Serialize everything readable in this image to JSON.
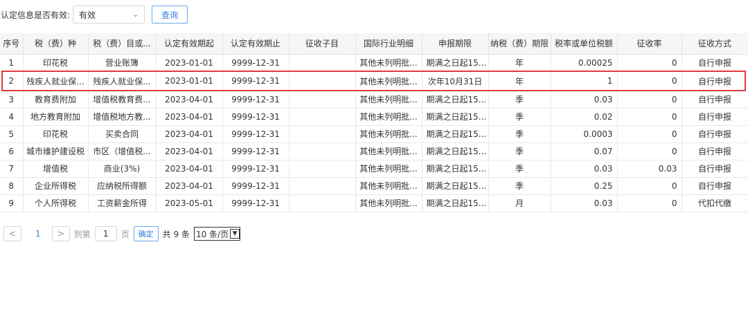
{
  "filter": {
    "label": "认定信息是否有效:",
    "select_value": "有效",
    "query_button": "查询"
  },
  "table": {
    "headers": [
      "序号",
      "税（费）种",
      "税（费）目或...",
      "认定有效期起",
      "认定有效期止",
      "征收子目",
      "国际行业明细",
      "申报期限",
      "纳税（费）期限",
      "税率或单位税额",
      "征收率",
      "征收方式"
    ],
    "rows": [
      [
        "1",
        "印花税",
        "营业账簿",
        "2023-01-01",
        "9999-12-31",
        "",
        "其他未列明批...",
        "期满之日起15...",
        "年",
        "0.00025",
        "0",
        "自行申报"
      ],
      [
        "2",
        "残疾人就业保...",
        "残疾人就业保...",
        "2023-01-01",
        "9999-12-31",
        "",
        "其他未列明批...",
        "次年10月31日",
        "年",
        "1",
        "0",
        "自行申报"
      ],
      [
        "3",
        "教育费附加",
        "增值税教育费...",
        "2023-04-01",
        "9999-12-31",
        "",
        "其他未列明批...",
        "期满之日起15...",
        "季",
        "0.03",
        "0",
        "自行申报"
      ],
      [
        "4",
        "地方教育附加",
        "增值税地方教...",
        "2023-04-01",
        "9999-12-31",
        "",
        "其他未列明批...",
        "期满之日起15...",
        "季",
        "0.02",
        "0",
        "自行申报"
      ],
      [
        "5",
        "印花税",
        "买卖合同",
        "2023-04-01",
        "9999-12-31",
        "",
        "其他未列明批...",
        "期满之日起15...",
        "季",
        "0.0003",
        "0",
        "自行申报"
      ],
      [
        "6",
        "城市维护建设税",
        "市区（增值税...",
        "2023-04-01",
        "9999-12-31",
        "",
        "其他未列明批...",
        "期满之日起15...",
        "季",
        "0.07",
        "0",
        "自行申报"
      ],
      [
        "7",
        "增值税",
        "商业(3%)",
        "2023-04-01",
        "9999-12-31",
        "",
        "其他未列明批...",
        "期满之日起15...",
        "季",
        "0.03",
        "0.03",
        "自行申报"
      ],
      [
        "8",
        "企业所得税",
        "应纳税所得额",
        "2023-04-01",
        "9999-12-31",
        "",
        "其他未列明批...",
        "期满之日起15...",
        "季",
        "0.25",
        "0",
        "自行申报"
      ],
      [
        "9",
        "个人所得税",
        "工资薪金所得",
        "2023-05-01",
        "9999-12-31",
        "",
        "其他未列明批...",
        "期满之日起15...",
        "月",
        "0.03",
        "0",
        "代扣代缴"
      ]
    ]
  },
  "pager": {
    "prev_icon": "chevron-left-icon",
    "next_icon": "chevron-right-icon",
    "prev": "<",
    "next": ">",
    "current_page": "1",
    "goto_label": "到第",
    "goto_value": "1",
    "page_suffix": "页",
    "confirm": "确定",
    "total": "共 9 条",
    "page_size": "10 条/页"
  },
  "colors": {
    "accent": "#2d7ddb",
    "highlight": "#e03a3a",
    "header_bg": "#f5f6f7"
  }
}
